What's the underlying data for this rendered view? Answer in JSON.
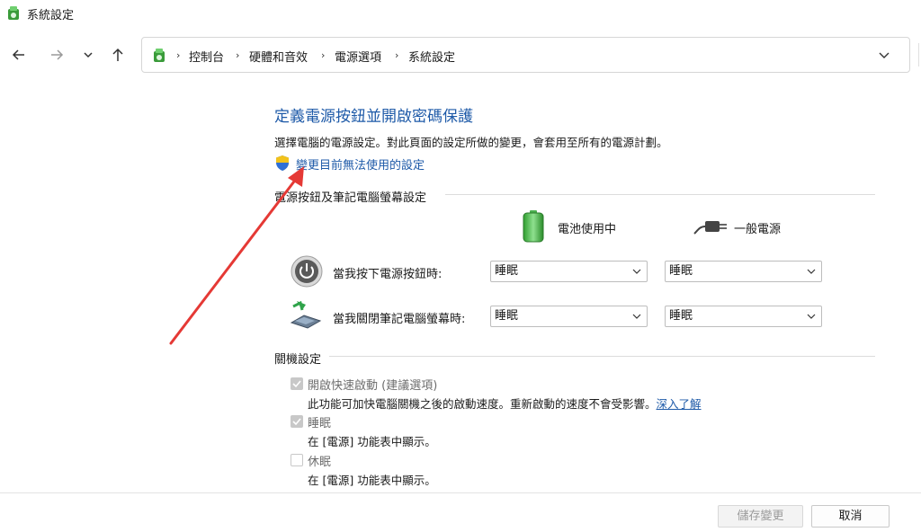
{
  "window": {
    "title": "系統設定"
  },
  "address": {
    "crumbs": [
      "控制台",
      "硬體和音效",
      "電源選項",
      "系統設定"
    ],
    "separator": "›"
  },
  "content": {
    "heading": "定義電源按鈕並開啟密碼保護",
    "description": "選擇電腦的電源設定。對此頁面的設定所做的變更，會套用至所有的電源計劃。",
    "change_link": "變更目前無法使用的設定"
  },
  "power_section": {
    "title": "電源按鈕及筆記電腦螢幕設定",
    "battery_label": "電池使用中",
    "plugged_label": "一般電源",
    "rows": [
      {
        "label": "當我按下電源按鈕時:",
        "battery_value": "睡眠",
        "plugged_value": "睡眠"
      },
      {
        "label": "當我關閉筆記電腦螢幕時:",
        "battery_value": "睡眠",
        "plugged_value": "睡眠"
      }
    ]
  },
  "shutdown_section": {
    "title": "關機設定",
    "options": [
      {
        "label": "開啟快速啟動 (建議選項)",
        "checked": true,
        "desc": "此功能可加快電腦關機之後的啟動速度。重新啟動的速度不會受影響。",
        "link": "深入了解"
      },
      {
        "label": "睡眠",
        "checked": true,
        "desc": "在 [電源] 功能表中顯示。"
      },
      {
        "label": "休眠",
        "checked": false,
        "desc": "在 [電源] 功能表中顯示。"
      }
    ]
  },
  "buttons": {
    "save": "儲存變更",
    "cancel": "取消"
  },
  "colors": {
    "link": "#1e5aa8",
    "annotation_arrow": "#e53935"
  }
}
